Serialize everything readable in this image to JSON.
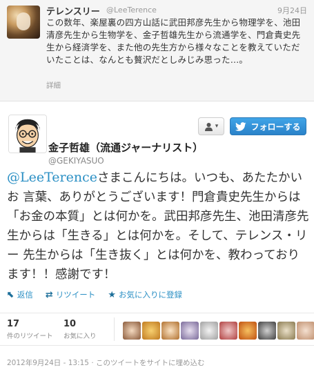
{
  "reply": {
    "name": "テレンスリー",
    "screen_name": "@LeeTerence",
    "date": "9月24日",
    "text": "この数年、楽屋裏の四方山話に武田邦彦先生から物理学を、池田清彦先生から生物学を、金子哲雄先生から流通学を、門倉貴史先生から経済学を、また他の先生方から様々なことを教えていただいたことは、なんとも贅沢だとしみじみ思った…。",
    "detail": "詳細"
  },
  "tweet": {
    "author_name": "金子哲雄（流通ジャーナリスト）",
    "screen_name": "@GEKIYASUO",
    "mention": "@LeeTerence",
    "text": "さまこんにちは。いつも、あたたかいお 言葉、ありがとうございます！門倉貴史先生からは「お金の本質」とは何かを。武田邦彦先生、池田清彦先生からは「生きる」とは何かを。そして、テレンス・リー 先生からは「生き抜く」とは何かを、教わっております！！感謝です！"
  },
  "buttons": {
    "user_menu_icon": "person-icon",
    "follow_label": "フォローする"
  },
  "actions": {
    "reply": "返信",
    "retweet": "リツイート",
    "favorite": "お気に入りに登録"
  },
  "stats": {
    "retweets_count": "17",
    "retweets_label": "件のリツイート",
    "favorites_count": "10",
    "favorites_label": "お気に入り"
  },
  "footer": {
    "timestamp": "2012年9月24日 - 13:15",
    "separator": " · ",
    "embed": "このツイートをサイトに埋め込む"
  },
  "colors": {
    "link": "#2a8fc4",
    "follow_button": "#2a82c9",
    "muted": "#999999"
  }
}
